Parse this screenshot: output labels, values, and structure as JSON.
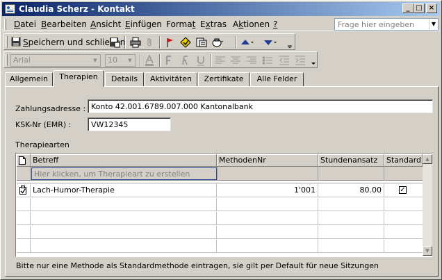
{
  "window": {
    "title": "Claudia Scherz - Kontakt",
    "controls": {
      "min": "_",
      "max": "□",
      "close": "×"
    }
  },
  "menu": {
    "items": [
      {
        "pre": "",
        "key": "D",
        "post": "atei"
      },
      {
        "pre": "",
        "key": "B",
        "post": "earbeiten"
      },
      {
        "pre": "",
        "key": "A",
        "post": "nsicht"
      },
      {
        "pre": "",
        "key": "E",
        "post": "infügen"
      },
      {
        "pre": "Forma",
        "key": "t",
        "post": ""
      },
      {
        "pre": "E",
        "key": "x",
        "post": "tras"
      },
      {
        "pre": "A",
        "key": "k",
        "post": "tionen"
      },
      {
        "pre": "",
        "key": "?",
        "post": ""
      }
    ],
    "help_placeholder": "Frage hier eingeben"
  },
  "toolbar": {
    "save_close_pre": "",
    "save_close_key": "S",
    "save_close_post": "peichern und schließen"
  },
  "format_toolbar": {
    "font": "Arial",
    "size": "10"
  },
  "tabs": [
    {
      "label": "Allgemein"
    },
    {
      "label": "Therapien"
    },
    {
      "label": "Details"
    },
    {
      "label": "Aktivitäten"
    },
    {
      "label": "Zertifikate"
    },
    {
      "label": "Alle Felder"
    }
  ],
  "form": {
    "payment_label": "Zahlungsadresse :",
    "payment_value": "Konto 42.001.6789.007.000 Kantonalbank",
    "ksk_label": "KSK-Nr (EMR) :",
    "ksk_value": "VW12345",
    "section_label": "Therapiearten"
  },
  "grid": {
    "columns": {
      "subject": "Betreff",
      "method": "MethodenNr",
      "rate": "Stundenansatz",
      "default": "Standard"
    },
    "new_row_placeholder": "Hier klicken, um Therapieart zu erstellen",
    "rows": [
      {
        "subject": "Lach-Humor-Therapie",
        "method": "1'001",
        "rate": "80.00",
        "default_mark": "✓"
      }
    ]
  },
  "footer": "Bitte nur eine Methode als Standardmethode eintragen, sie gilt per Default für neue Sitzungen",
  "colors": {
    "title_start": "#0a246a",
    "title_end": "#a6caf0",
    "face": "#d4d0c8"
  }
}
